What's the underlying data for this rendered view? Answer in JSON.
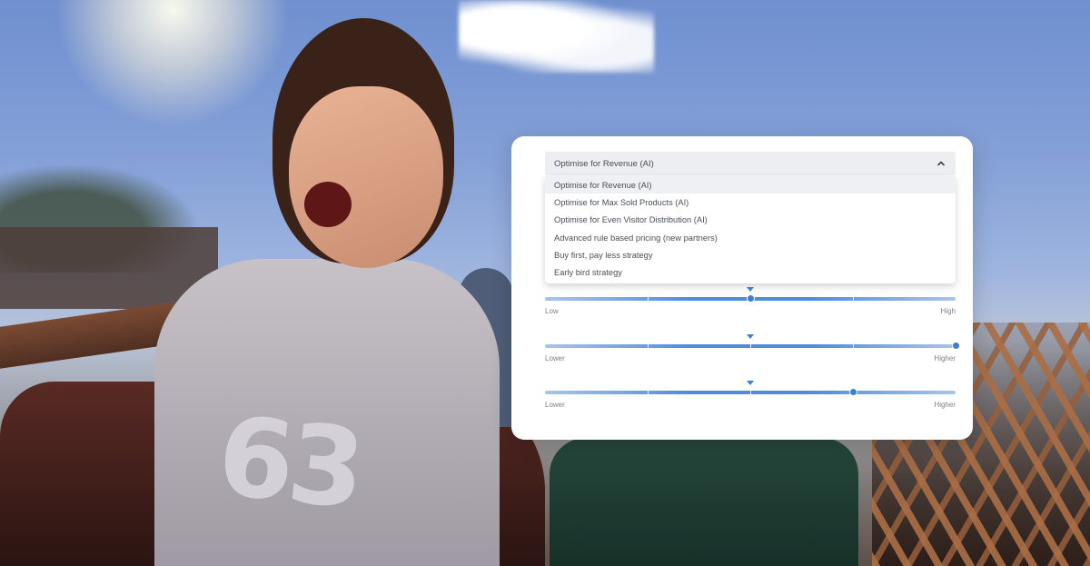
{
  "strategy_select": {
    "selected": "Optimise for Revenue (AI)",
    "expanded": true,
    "options": [
      "Optimise for Revenue (AI)",
      "Optimise for Max Sold Products (AI)",
      "Optimise for Even Visitor Distribution (AI)",
      "Advanced rule based pricing (new partners)",
      "Buy first, pay less strategy",
      "Early bird strategy"
    ],
    "selected_index": 0
  },
  "sliders": [
    {
      "min_label": "Low",
      "max_label": "High",
      "value": 0.5
    },
    {
      "min_label": "Lower",
      "max_label": "Higher",
      "value": 1.0
    },
    {
      "min_label": "Lower",
      "max_label": "Higher",
      "value": 0.75
    }
  ],
  "colors": {
    "accent": "#3e7fd4",
    "card_bg": "#ffffff",
    "select_bg": "#eceef1"
  },
  "icons": {
    "select_toggle": "chevron-up-icon",
    "default_marker": "caret-down-icon"
  }
}
